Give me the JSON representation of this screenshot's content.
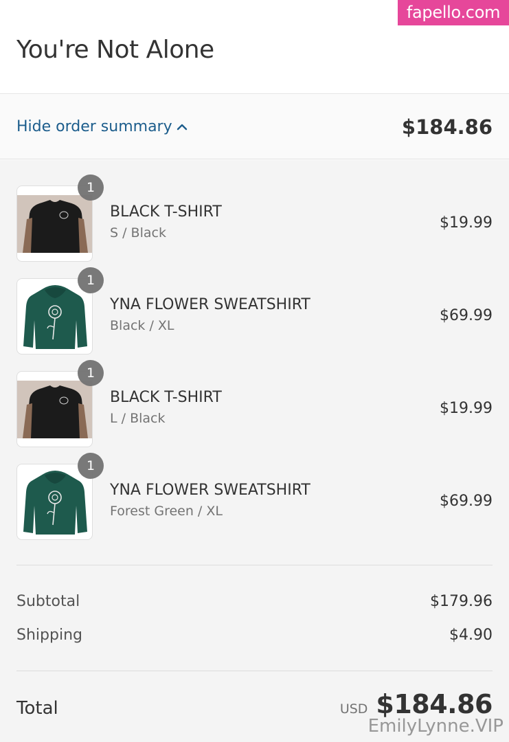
{
  "watermarks": {
    "top": "fapello.com",
    "bottom": "EmilyLynne.VIP"
  },
  "store": {
    "title": "You're Not Alone"
  },
  "summary_toggle": {
    "label": "Hide order summary",
    "icon": "chevron-up-icon",
    "total": "$184.86"
  },
  "products": [
    {
      "quantity": "1",
      "name": "BLACK T-SHIRT",
      "variant": "S / Black",
      "price": "$19.99",
      "image": "black-tshirt"
    },
    {
      "quantity": "1",
      "name": "YNA FLOWER SWEATSHIRT",
      "variant": "Black / XL",
      "price": "$69.99",
      "image": "green-hoodie"
    },
    {
      "quantity": "1",
      "name": "BLACK T-SHIRT",
      "variant": "L / Black",
      "price": "$19.99",
      "image": "black-tshirt"
    },
    {
      "quantity": "1",
      "name": "YNA FLOWER SWEATSHIRT",
      "variant": "Forest Green / XL",
      "price": "$69.99",
      "image": "green-hoodie"
    }
  ],
  "totals": {
    "subtotal_label": "Subtotal",
    "subtotal_value": "$179.96",
    "shipping_label": "Shipping",
    "shipping_value": "$4.90",
    "total_label": "Total",
    "currency": "USD",
    "total_value": "$184.86"
  },
  "colors": {
    "link": "#1c5d8c",
    "badge": "#727272",
    "watermark": "#e6479a",
    "hoodie": "#1e5a4d"
  }
}
